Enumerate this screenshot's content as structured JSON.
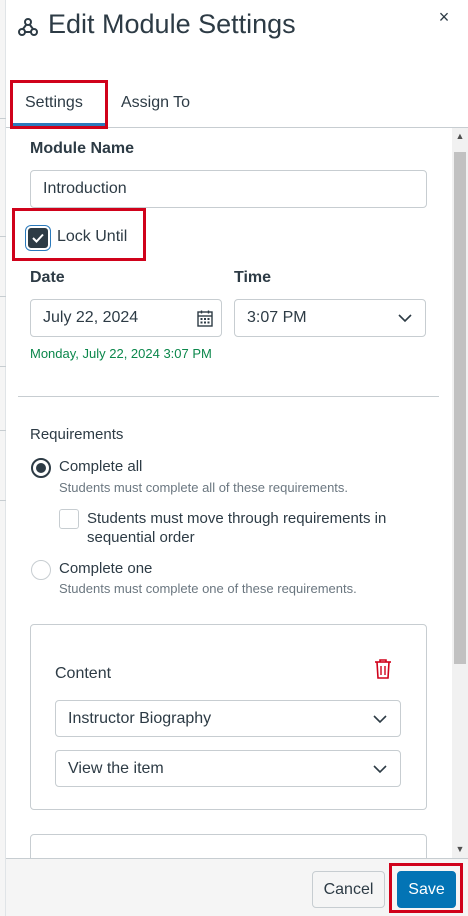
{
  "header": {
    "title": "Edit Module Settings",
    "close_symbol": "×"
  },
  "tabs": [
    {
      "label": "Settings",
      "selected": true
    },
    {
      "label": "Assign To",
      "selected": false
    }
  ],
  "module_name": {
    "label": "Module Name",
    "value": "Introduction"
  },
  "lock_until": {
    "label": "Lock Until",
    "checked": true
  },
  "date": {
    "label": "Date",
    "value": "July 22, 2024"
  },
  "time": {
    "label": "Time",
    "value": "3:07 PM"
  },
  "lock_summary": "Monday, July 22, 2024 3:07 PM",
  "requirements": {
    "label": "Requirements",
    "complete_all": {
      "label": "Complete all",
      "description": "Students must complete all of these requirements.",
      "selected": true
    },
    "sequential": {
      "label_line1": "Students must move through requirements in",
      "label_line2": "sequential order",
      "checked": false
    },
    "complete_one": {
      "label": "Complete one",
      "description": "Students must complete one of these requirements.",
      "selected": false
    }
  },
  "requirement_card": {
    "label": "Content",
    "item_select": "Instructor Biography",
    "action_select": "View the item"
  },
  "footer": {
    "cancel_label": "Cancel",
    "save_label": "Save"
  },
  "colors": {
    "highlight": "#d0021b",
    "accent": "#2b7abc",
    "primary_button": "#0374b5",
    "success_text": "#0b874b",
    "delete_icon": "#d0021b"
  },
  "icons": {
    "module": "module-icon",
    "close": "close-icon",
    "calendar": "calendar-icon",
    "chevron": "chevron-down-icon",
    "trash": "trash-icon"
  }
}
